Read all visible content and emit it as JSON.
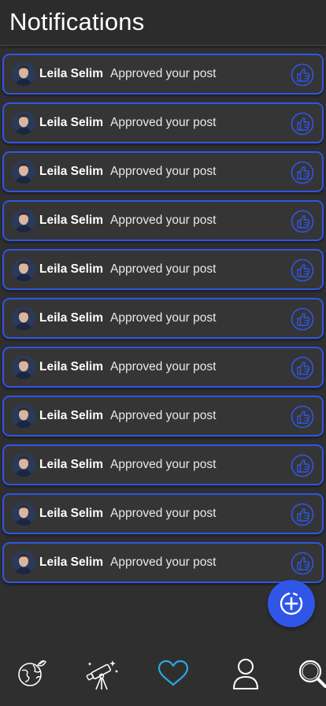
{
  "header": {
    "title": "Notifications"
  },
  "notifications": [
    {
      "name": "Leila Selim",
      "action": "Approved your post",
      "icon": "thumbs-up-icon"
    },
    {
      "name": "Leila Selim",
      "action": "Approved your post",
      "icon": "thumbs-up-icon"
    },
    {
      "name": "Leila Selim",
      "action": "Approved your post",
      "icon": "thumbs-up-icon"
    },
    {
      "name": "Leila Selim",
      "action": "Approved your post",
      "icon": "thumbs-up-icon"
    },
    {
      "name": "Leila Selim",
      "action": "Approved your post",
      "icon": "thumbs-up-icon"
    },
    {
      "name": "Leila Selim",
      "action": "Approved your post",
      "icon": "thumbs-up-icon"
    },
    {
      "name": "Leila Selim",
      "action": "Approved your post",
      "icon": "thumbs-up-icon"
    },
    {
      "name": "Leila Selim",
      "action": "Approved your post",
      "icon": "thumbs-up-icon"
    },
    {
      "name": "Leila Selim",
      "action": "Approved your post",
      "icon": "thumbs-up-icon"
    },
    {
      "name": "Leila Selim",
      "action": "Approved your post",
      "icon": "thumbs-up-icon"
    },
    {
      "name": "Leila Selim",
      "action": "Approved your post",
      "icon": "thumbs-up-icon"
    }
  ],
  "fab": {
    "icon": "add-circle-icon"
  },
  "bottom_nav": {
    "items": [
      {
        "icon": "globe-icon",
        "active": false
      },
      {
        "icon": "telescope-icon",
        "active": false
      },
      {
        "icon": "heart-icon",
        "active": true
      },
      {
        "icon": "user-icon",
        "active": false
      },
      {
        "icon": "search-icon",
        "active": false
      }
    ]
  },
  "colors": {
    "background": "#2f2f2f",
    "card": "#353535",
    "accent": "#2f56e6",
    "active_nav": "#29a9e0",
    "text": "#ffffff"
  }
}
